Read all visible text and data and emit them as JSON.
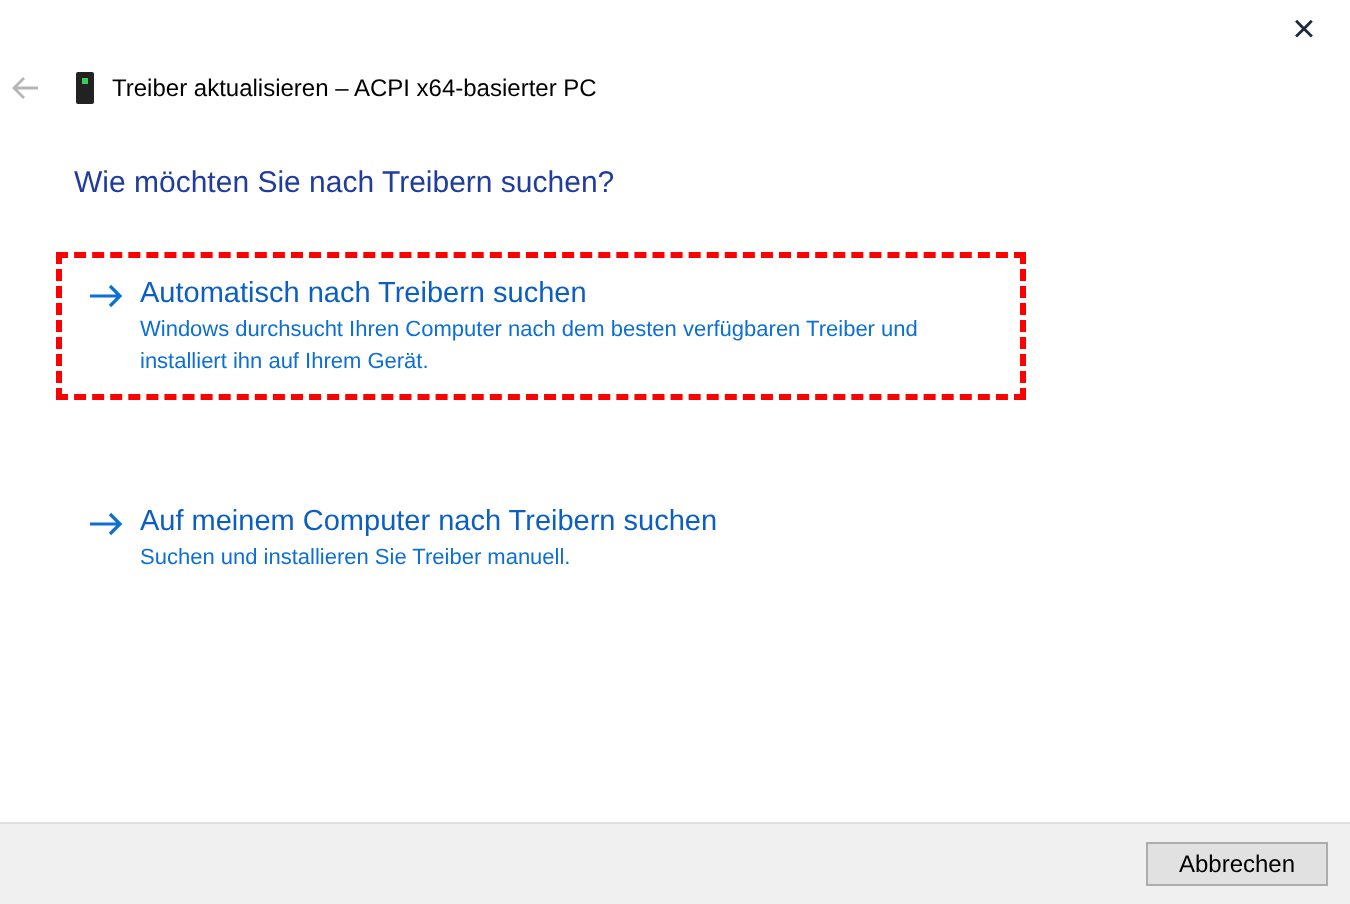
{
  "window": {
    "title": "Treiber aktualisieren – ACPI x64-basierter PC",
    "close": "×"
  },
  "heading": "Wie möchten Sie nach Treibern suchen?",
  "options": [
    {
      "title": "Automatisch nach Treibern suchen",
      "description": "Windows durchsucht Ihren Computer nach dem besten verfügbaren Treiber und installiert ihn auf Ihrem Gerät.",
      "highlighted": true
    },
    {
      "title": "Auf meinem Computer nach Treibern suchen",
      "description": "Suchen und installieren Sie Treiber manuell.",
      "highlighted": false
    }
  ],
  "buttons": [
    "Abbrechen"
  ]
}
